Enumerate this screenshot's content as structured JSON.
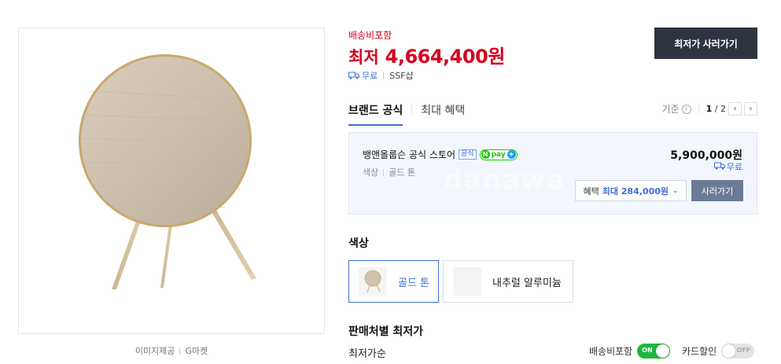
{
  "product_image": {
    "credit_label": "이미지제공",
    "credit_source": "G마켓"
  },
  "summary": {
    "shipping_note": "배송비포함",
    "price_prefix": "최저",
    "price": "4,664,400원",
    "delivery": "무료",
    "mall": "SSF샵",
    "buy_button": "최저가 사러가기"
  },
  "tabs": {
    "items": [
      {
        "label": "브랜드 공식",
        "active": true
      },
      {
        "label": "최대 혜택",
        "active": false
      }
    ],
    "basis_label": "기준",
    "page_current": "1",
    "page_total": "2"
  },
  "store_card": {
    "name": "뱅앤올룹슨 공식 스토어",
    "official_badge": "공식",
    "npay_label": "pay",
    "option_label": "색상",
    "option_value": "골드 톤",
    "price": "5,900,000원",
    "delivery": "무료",
    "benefit_prefix": "혜택",
    "benefit_value": "최대 284,000원",
    "buy_button": "사러가기",
    "watermark": "danawa"
  },
  "color_section": {
    "title": "색상",
    "options": [
      {
        "label": "골드 톤",
        "selected": true
      },
      {
        "label": "내추럴 알루미늄",
        "selected": false
      }
    ]
  },
  "seller_section": {
    "title": "판매처별 최저가",
    "sort_label": "최저가순",
    "toggles": [
      {
        "label": "배송비포함",
        "state": "ON"
      },
      {
        "label": "카드할인",
        "state": "OFF"
      }
    ]
  },
  "colors": {
    "price_red": "#d4001f",
    "accent_blue": "#3d6fd8",
    "dark_button": "#2e3440",
    "toggle_on": "#1db73e"
  }
}
